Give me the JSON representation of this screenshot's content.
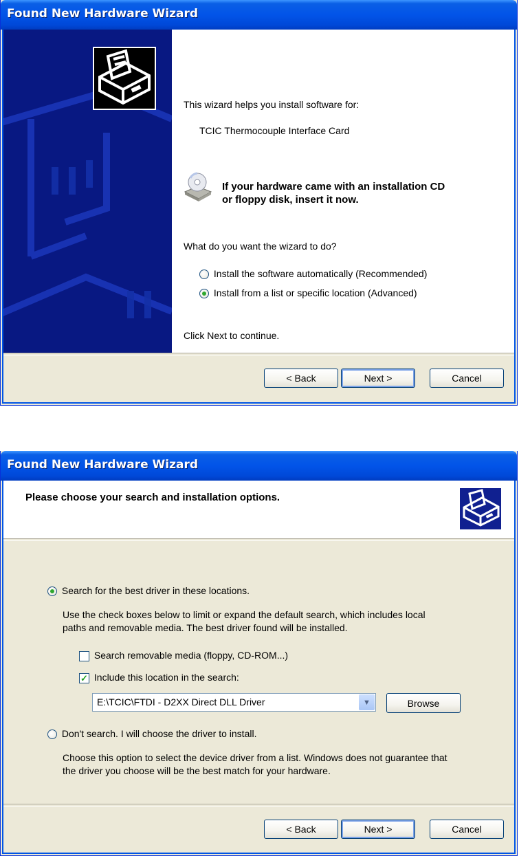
{
  "window1": {
    "title": "Found New Hardware Wizard",
    "intro": "This wizard helps you install software for:",
    "device": "TCIC Thermocouple Interface Card",
    "cd_prompt_line1": "If your hardware came with an installation CD",
    "cd_prompt_line2": "or floppy disk, insert it now.",
    "question": "What do you want the wizard to do?",
    "options": [
      {
        "label": "Install the software automatically (Recommended)",
        "selected": false
      },
      {
        "label": "Install from a list or specific location (Advanced)",
        "selected": true
      }
    ],
    "continue_hint": "Click Next to continue.",
    "buttons": {
      "back": "< Back",
      "next": "Next >",
      "cancel": "Cancel"
    }
  },
  "window2": {
    "title": "Found New Hardware Wizard",
    "header": "Please choose your search and installation options.",
    "search_option": {
      "label": "Search for the best driver in these locations.",
      "selected": true
    },
    "search_desc_line1": "Use the check boxes below to limit or expand the default search, which includes local",
    "search_desc_line2": "paths and removable media. The best driver found will be installed.",
    "check_removable": {
      "label": "Search removable media (floppy, CD-ROM...)",
      "checked": false
    },
    "check_location": {
      "label": "Include this location in the search:",
      "checked": true
    },
    "location_value": "E:\\TCIC\\FTDI - D2XX Direct DLL Driver",
    "browse_label": "Browse",
    "dont_search_option": {
      "label": "Don't search. I will choose the driver to install.",
      "selected": false
    },
    "dont_desc_line1": "Choose this option to select the device driver from a list.  Windows does not guarantee that",
    "dont_desc_line2": "the driver you choose will be the best match for your hardware.",
    "buttons": {
      "back": "< Back",
      "next": "Next >",
      "cancel": "Cancel"
    }
  },
  "colors": {
    "titlebar": "#0054e3",
    "banner": "#081882",
    "dialog_bg": "#ece9d8",
    "radio_dot": "#2fa72f"
  }
}
